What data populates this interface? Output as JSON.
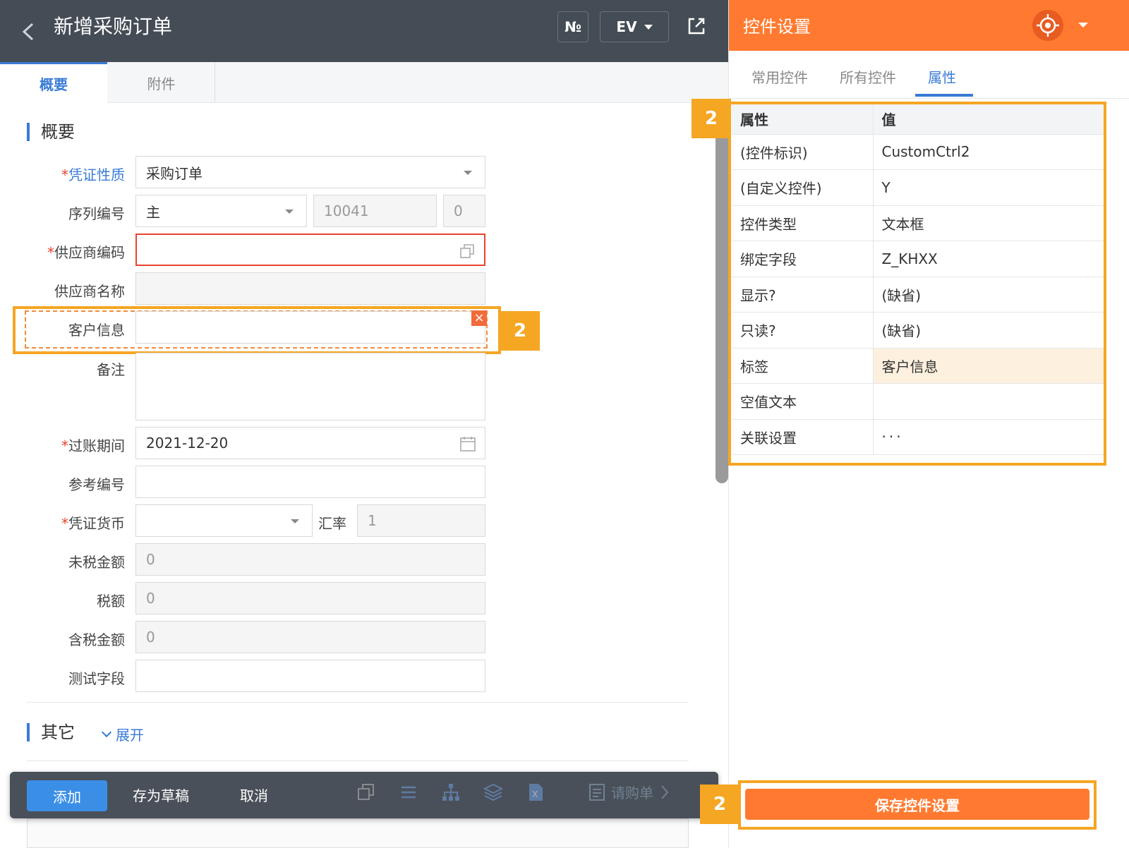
{
  "header": {
    "title": "新增采购订单",
    "no_label": "№",
    "ev_label": "EV"
  },
  "tabs": [
    "概要",
    "附件"
  ],
  "sections": {
    "overview": "概要",
    "other": "其它",
    "expand": "展开"
  },
  "form": {
    "voucher_type": {
      "label": "凭证性质",
      "value": "采购订单"
    },
    "serial": {
      "label": "序列编号",
      "value": "主",
      "number": "10041",
      "seq": "0"
    },
    "supplier_code": {
      "label": "供应商编码",
      "value": ""
    },
    "supplier_name": {
      "label": "供应商名称",
      "value": ""
    },
    "customer_info": {
      "label": "客户信息",
      "value": ""
    },
    "remark": {
      "label": "备注",
      "value": ""
    },
    "posting_period": {
      "label": "过账期间",
      "value": "2021-12-20"
    },
    "ref_no": {
      "label": "参考编号",
      "value": ""
    },
    "currency": {
      "label": "凭证货币",
      "value": "",
      "rate_label": "汇率",
      "rate": "1"
    },
    "pre_tax": {
      "label": "未税金额",
      "value": "0"
    },
    "tax": {
      "label": "税额",
      "value": "0"
    },
    "with_tax": {
      "label": "含税金额",
      "value": "0"
    },
    "test_field": {
      "label": "测试字段",
      "value": ""
    }
  },
  "badges": {
    "b1": "2",
    "b2": "2",
    "b3": "2"
  },
  "bottom_bar": {
    "add": "添加",
    "draft": "存为草稿",
    "cancel": "取消",
    "requisition": "请购单"
  },
  "panel": {
    "title": "控件设置",
    "tabs": {
      "common": "常用控件",
      "all": "所有控件",
      "props": "属性"
    },
    "table_header": {
      "key": "属性",
      "value": "值"
    },
    "rows": [
      {
        "key": "(控件标识)",
        "value": "CustomCtrl2"
      },
      {
        "key": "(自定义控件)",
        "value": "Y"
      },
      {
        "key": "控件类型",
        "value": "文本框"
      },
      {
        "key": "绑定字段",
        "value": "Z_KHXX"
      },
      {
        "key": "显示?",
        "value": "(缺省)"
      },
      {
        "key": "只读?",
        "value": "(缺省)"
      },
      {
        "key": "标签",
        "value": "客户信息"
      },
      {
        "key": "空值文本",
        "value": ""
      },
      {
        "key": "关联设置",
        "value": "···"
      }
    ],
    "save": "保存控件设置"
  },
  "colors": {
    "accent_orange": "#ff7a30",
    "highlight": "#f5a623",
    "link_blue": "#3a7bd5",
    "topbar": "#444c55"
  }
}
